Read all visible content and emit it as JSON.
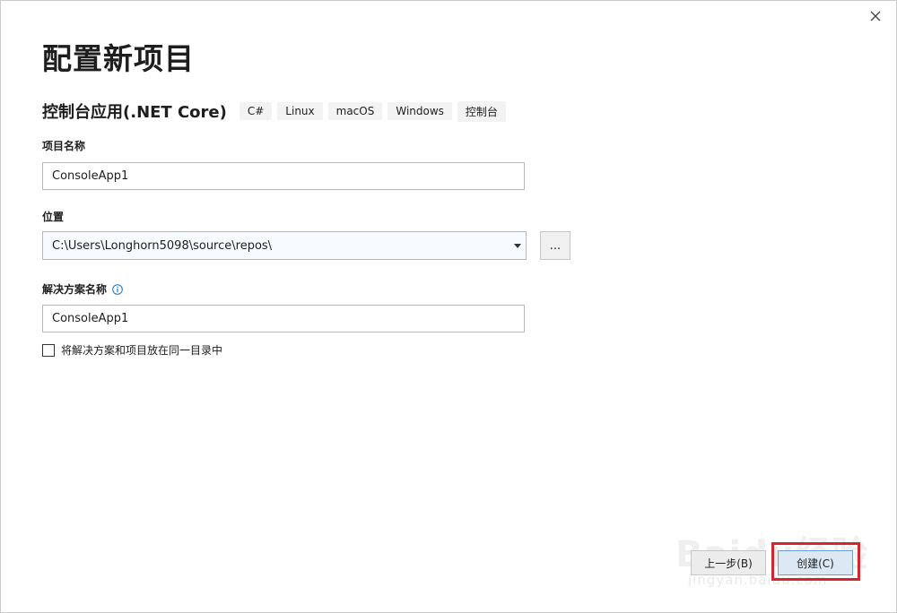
{
  "dialog": {
    "title": "配置新项目",
    "close_icon": "close-icon"
  },
  "template": {
    "name": "控制台应用(.NET Core)",
    "tags": [
      "C#",
      "Linux",
      "macOS",
      "Windows",
      "控制台"
    ]
  },
  "project_name": {
    "label": "项目名称",
    "value": "ConsoleApp1"
  },
  "location": {
    "label": "位置",
    "value": "C:\\Users\\Longhorn5098\\source\\repos\\",
    "browse_label": "..."
  },
  "solution_name": {
    "label": "解决方案名称",
    "info_icon": "info-icon",
    "value": "ConsoleApp1"
  },
  "same_directory": {
    "label": "将解决方案和项目放在同一目录中",
    "checked": false
  },
  "footer": {
    "back_label": "上一步(B)",
    "create_label": "创建(C)"
  },
  "watermark": {
    "brand": "Baidu经验",
    "url": "jingyan.baidu.com"
  },
  "colors": {
    "highlight": "#d3262f",
    "info": "#1a73c9",
    "primary_button_border": "#6d9fd3"
  }
}
